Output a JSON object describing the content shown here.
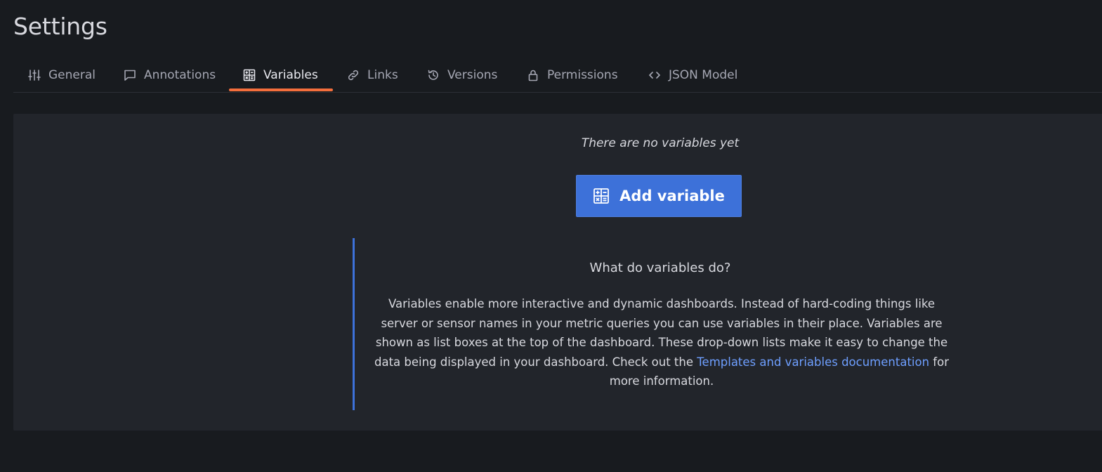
{
  "header": {
    "title": "Settings"
  },
  "tabs": [
    {
      "label": "General",
      "icon": "sliders-icon",
      "active": false
    },
    {
      "label": "Annotations",
      "icon": "comment-icon",
      "active": false
    },
    {
      "label": "Variables",
      "icon": "calculator-icon",
      "active": true
    },
    {
      "label": "Links",
      "icon": "link-icon",
      "active": false
    },
    {
      "label": "Versions",
      "icon": "history-icon",
      "active": false
    },
    {
      "label": "Permissions",
      "icon": "lock-icon",
      "active": false
    },
    {
      "label": "JSON Model",
      "icon": "code-icon",
      "active": false
    }
  ],
  "main": {
    "empty_text": "There are no variables yet",
    "add_button": {
      "label": "Add variable",
      "icon": "calculator-icon"
    },
    "info": {
      "title": "What do variables do?",
      "body_text": "Variables enable more interactive and dynamic dashboards. Instead of hard-coding things like server or sensor names in your metric queries you can use variables in their place. Variables are shown as list boxes at the top of the dashboard. These drop-down lists make it easy to change the data being displayed in your dashboard. Check out the ",
      "link_text": "Templates and variables documentation",
      "body_suffix": " for more information."
    }
  },
  "colors": {
    "background": "#181b1f",
    "panel": "#22252b",
    "accent_tab": "#f46e3c",
    "primary_button": "#3d71d9",
    "link": "#6e9fff"
  }
}
